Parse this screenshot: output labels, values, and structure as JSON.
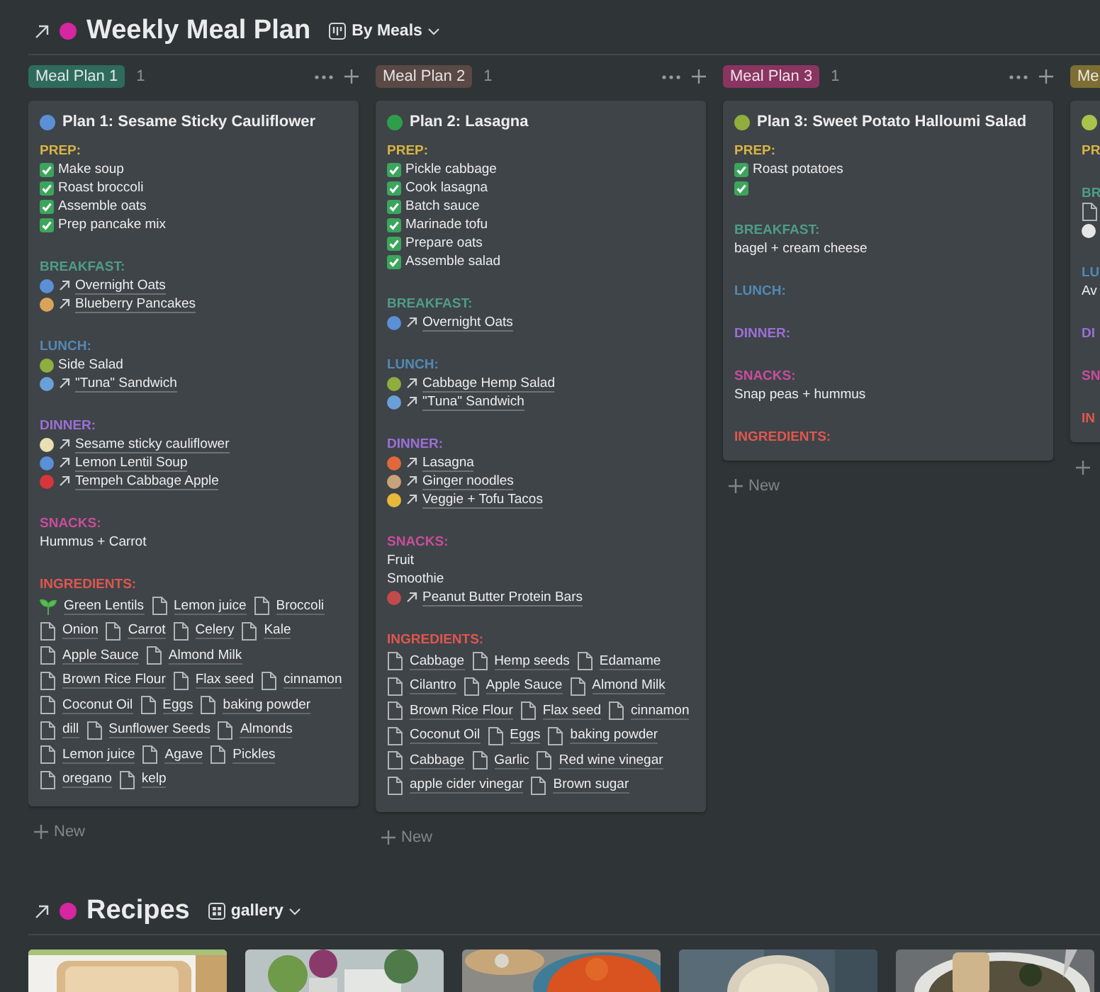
{
  "board": {
    "title": "Weekly Meal Plan",
    "view": "By Meals",
    "columns": [
      {
        "tag": "Meal Plan 1",
        "color": "#2f6b5c",
        "count": "1",
        "new_label": "New",
        "card": {
          "color": "#5b8fd6",
          "title": "Plan 1: Sesame Sticky Cauliflower",
          "sections": [
            {
              "kind": "prep",
              "label": "PREP:",
              "items": [
                {
                  "kind": "check",
                  "text": "Make soup"
                },
                {
                  "kind": "check",
                  "text": "Roast broccoli"
                },
                {
                  "kind": "check",
                  "text": "Assemble oats"
                },
                {
                  "kind": "check",
                  "text": "Prep pancake mix"
                }
              ]
            },
            {
              "kind": "breakfast",
              "label": "BREAKFAST:",
              "items": [
                {
                  "kind": "link",
                  "color": "#5b8fd6",
                  "text": "Overnight Oats"
                },
                {
                  "kind": "link",
                  "color": "#d9a45a",
                  "text": "Blueberry Pancakes"
                }
              ]
            },
            {
              "kind": "lunch",
              "label": "LUNCH:",
              "items": [
                {
                  "kind": "emoji",
                  "color": "#8fae3e",
                  "text": "Side Salad"
                },
                {
                  "kind": "link",
                  "color": "#6aa0d8",
                  "text": "\"Tuna\" Sandwich"
                }
              ]
            },
            {
              "kind": "dinner",
              "label": "DINNER:",
              "items": [
                {
                  "kind": "link",
                  "color": "#e8e0b0",
                  "text": "Sesame sticky cauliflower"
                },
                {
                  "kind": "link",
                  "color": "#5b8fd6",
                  "text": "Lemon Lentil Soup"
                },
                {
                  "kind": "link",
                  "color": "#d8343a",
                  "text": "Tempeh Cabbage Apple"
                }
              ]
            },
            {
              "kind": "snacks",
              "label": "SNACKS:",
              "items": [
                {
                  "kind": "text",
                  "text": "Hummus + Carrot"
                }
              ]
            },
            {
              "kind": "ingredients",
              "label": "INGREDIENTS:",
              "items": [
                {
                  "kind": "sprout",
                  "text": "Green Lentils"
                },
                {
                  "kind": "page",
                  "text": "Lemon juice"
                },
                {
                  "kind": "page",
                  "text": "Broccoli"
                },
                {
                  "kind": "page",
                  "text": "Onion"
                },
                {
                  "kind": "page",
                  "text": "Carrot"
                },
                {
                  "kind": "page",
                  "text": "Celery"
                },
                {
                  "kind": "page",
                  "text": "Kale"
                },
                {
                  "kind": "page",
                  "text": "Apple Sauce"
                },
                {
                  "kind": "page",
                  "text": "Almond Milk"
                },
                {
                  "kind": "page",
                  "text": "Brown Rice Flour"
                },
                {
                  "kind": "page",
                  "text": "Flax seed"
                },
                {
                  "kind": "page",
                  "text": "cinnamon"
                },
                {
                  "kind": "page",
                  "text": "Coconut Oil"
                },
                {
                  "kind": "page",
                  "text": "Eggs"
                },
                {
                  "kind": "page",
                  "text": "baking powder"
                },
                {
                  "kind": "page",
                  "text": "dill"
                },
                {
                  "kind": "page",
                  "text": "Sunflower Seeds"
                },
                {
                  "kind": "page",
                  "text": "Almonds"
                },
                {
                  "kind": "page",
                  "text": "Lemon juice"
                },
                {
                  "kind": "page",
                  "text": "Agave"
                },
                {
                  "kind": "page",
                  "text": "Pickles"
                },
                {
                  "kind": "page",
                  "text": "oregano"
                },
                {
                  "kind": "page",
                  "text": "kelp"
                }
              ]
            }
          ]
        }
      },
      {
        "tag": "Meal Plan 2",
        "color": "#5a4944",
        "count": "1",
        "new_label": "New",
        "card": {
          "color": "#2e9e4a",
          "title": "Plan 2: Lasagna",
          "sections": [
            {
              "kind": "prep",
              "label": "PREP:",
              "items": [
                {
                  "kind": "check",
                  "text": "Pickle cabbage"
                },
                {
                  "kind": "check",
                  "text": "Cook lasagna"
                },
                {
                  "kind": "check",
                  "text": "Batch sauce"
                },
                {
                  "kind": "check",
                  "text": "Marinade tofu"
                },
                {
                  "kind": "check",
                  "text": "Prepare oats"
                },
                {
                  "kind": "check",
                  "text": "Assemble salad"
                }
              ]
            },
            {
              "kind": "breakfast",
              "label": "BREAKFAST:",
              "items": [
                {
                  "kind": "link",
                  "color": "#5b8fd6",
                  "text": "Overnight Oats"
                }
              ]
            },
            {
              "kind": "lunch",
              "label": "LUNCH:",
              "items": [
                {
                  "kind": "link",
                  "color": "#8fae3e",
                  "text": "Cabbage Hemp Salad"
                },
                {
                  "kind": "link",
                  "color": "#6aa0d8",
                  "text": "\"Tuna\" Sandwich"
                }
              ]
            },
            {
              "kind": "dinner",
              "label": "DINNER:",
              "items": [
                {
                  "kind": "link",
                  "color": "#e0683a",
                  "text": "Lasagna"
                },
                {
                  "kind": "link",
                  "color": "#c9a27a",
                  "text": "Ginger noodles"
                },
                {
                  "kind": "link",
                  "color": "#e8b83a",
                  "text": "Veggie + Tofu Tacos"
                }
              ]
            },
            {
              "kind": "snacks",
              "label": "SNACKS:",
              "items": [
                {
                  "kind": "text",
                  "text": "Fruit"
                },
                {
                  "kind": "text",
                  "text": "Smoothie"
                },
                {
                  "kind": "link",
                  "color": "#c24a4a",
                  "text": "Peanut Butter Protein Bars"
                }
              ]
            },
            {
              "kind": "ingredients",
              "label": "INGREDIENTS:",
              "items": [
                {
                  "kind": "page",
                  "text": "Cabbage"
                },
                {
                  "kind": "page",
                  "text": "Hemp seeds"
                },
                {
                  "kind": "page",
                  "text": "Edamame"
                },
                {
                  "kind": "page",
                  "text": "Cilantro"
                },
                {
                  "kind": "page",
                  "text": "Apple Sauce"
                },
                {
                  "kind": "page",
                  "text": "Almond Milk"
                },
                {
                  "kind": "page",
                  "text": "Brown Rice Flour"
                },
                {
                  "kind": "page",
                  "text": "Flax seed"
                },
                {
                  "kind": "page",
                  "text": "cinnamon"
                },
                {
                  "kind": "page",
                  "text": "Coconut Oil"
                },
                {
                  "kind": "page",
                  "text": "Eggs"
                },
                {
                  "kind": "page",
                  "text": "baking powder"
                },
                {
                  "kind": "page",
                  "text": "Cabbage"
                },
                {
                  "kind": "page",
                  "text": "Garlic"
                },
                {
                  "kind": "page",
                  "text": "Red wine vinegar"
                },
                {
                  "kind": "page",
                  "text": "apple cider vinegar"
                },
                {
                  "kind": "page",
                  "text": "Brown sugar"
                }
              ]
            }
          ]
        }
      },
      {
        "tag": "Meal Plan 3",
        "color": "#8a3461",
        "count": "1",
        "new_label": "New",
        "card": {
          "color": "#8fae3e",
          "title": "Plan 3: Sweet Potato Halloumi Salad",
          "sections": [
            {
              "kind": "prep",
              "label": "PREP:",
              "items": [
                {
                  "kind": "check",
                  "text": "Roast potatoes"
                },
                {
                  "kind": "check"
                }
              ]
            },
            {
              "kind": "breakfast",
              "label": "BREAKFAST:",
              "items": [
                {
                  "kind": "text",
                  "text": "bagel + cream cheese"
                }
              ]
            },
            {
              "kind": "lunch",
              "label": "LUNCH:"
            },
            {
              "kind": "dinner",
              "label": "DINNER:"
            },
            {
              "kind": "snacks",
              "label": "SNACKS:",
              "items": [
                {
                  "kind": "text",
                  "text": "Snap peas + hummus"
                }
              ]
            },
            {
              "kind": "ingredients",
              "label": "INGREDIENTS:"
            }
          ]
        }
      },
      {
        "tag": "Me",
        "color": "#7d6e34",
        "card": {
          "color": "#a8c24a",
          "sections": [
            {
              "kind": "prep",
              "label": "PR"
            },
            {
              "kind": "breakfast",
              "label": "BR",
              "items": [
                {
                  "kind": "doc"
                },
                {
                  "kind": "emoji",
                  "color": "#e6e6e6"
                }
              ]
            },
            {
              "kind": "lunch",
              "label": "LU",
              "items": [
                {
                  "kind": "text",
                  "text": "Av"
                }
              ]
            },
            {
              "kind": "dinner",
              "label": "DI"
            },
            {
              "kind": "snacks",
              "label": "SN"
            },
            {
              "kind": "ingredients",
              "label": "IN"
            }
          ]
        }
      }
    ]
  },
  "recipes": {
    "title": "Recipes",
    "view": "gallery"
  }
}
